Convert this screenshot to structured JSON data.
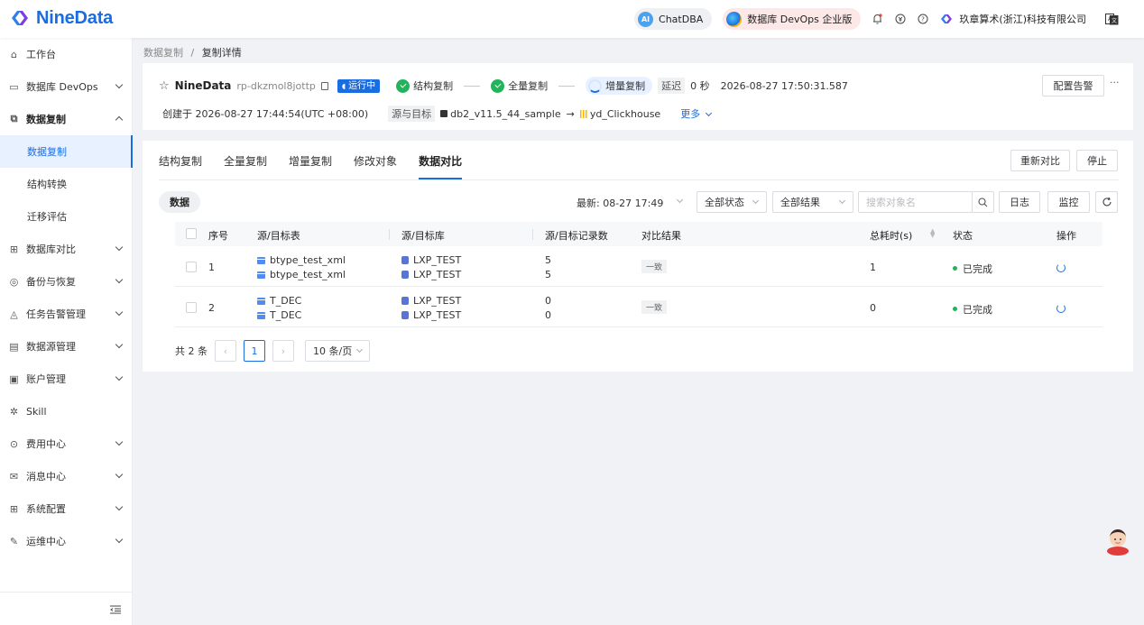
{
  "brand": {
    "name": "NineData",
    "color": "#1a6de0"
  },
  "topbar": {
    "chatdba": "ChatDBA",
    "devops": "数据库 DevOps 企业版",
    "company": "玖章算术(浙江)科技有限公司",
    "icons": [
      "bell-icon",
      "currency-icon",
      "help-icon",
      "translate-icon"
    ]
  },
  "sidebar": {
    "items": [
      {
        "label": "工作台",
        "icon": "home-icon"
      },
      {
        "label": "数据库 DevOps",
        "icon": "devops-icon"
      },
      {
        "label": "数据复制",
        "icon": "replication-icon"
      },
      {
        "label": "数据复制"
      },
      {
        "label": "结构转换"
      },
      {
        "label": "迁移评估"
      },
      {
        "label": "数据库对比",
        "icon": "compare-icon"
      },
      {
        "label": "备份与恢复",
        "icon": "backup-icon"
      },
      {
        "label": "任务告警管理",
        "icon": "alarm-icon"
      },
      {
        "label": "数据源管理",
        "icon": "datasource-icon"
      },
      {
        "label": "账户管理",
        "icon": "account-icon"
      },
      {
        "label": "Skill",
        "icon": "skill-icon"
      },
      {
        "label": "费用中心",
        "icon": "billing-icon"
      },
      {
        "label": "消息中心",
        "icon": "message-icon"
      },
      {
        "label": "系统配置",
        "icon": "settings-icon"
      },
      {
        "label": "运维中心",
        "icon": "ops-icon"
      }
    ]
  },
  "breadcrumb": {
    "parent": "数据复制",
    "sep": "/",
    "current": "复制详情"
  },
  "task": {
    "name": "NineData",
    "id": "rp-dkzmol8jottp",
    "status": "运行中",
    "steps": [
      "结构复制",
      "全量复制",
      "增量复制"
    ],
    "delay_label": "延迟",
    "delay_value": "0 秒",
    "timestamp": "2026-08-27 17:50:31.587",
    "created": "创建于 2026-08-27 17:44:54(UTC +08:00)",
    "src_tgt_label": "源与目标",
    "source": "db2_v11.5_44_sample",
    "arrow": "→",
    "target": "yd_Clickhouse",
    "more": "更多",
    "alert_btn": "配置告警",
    "more_icon": "···"
  },
  "tabs": [
    "结构复制",
    "全量复制",
    "增量复制",
    "修改对象",
    "数据对比"
  ],
  "active_tab": "数据对比",
  "actions": {
    "recompare": "重新对比",
    "stop": "停止"
  },
  "filters": {
    "chip": "数据",
    "latest": "最新: 08-27 17:49",
    "status": "全部状态",
    "result": "全部结果",
    "search_placeholder": "搜索对象名",
    "log": "日志",
    "monitor": "监控"
  },
  "table": {
    "headers": [
      "序号",
      "源/目标表",
      "源/目标库",
      "源/目标记录数",
      "对比结果",
      "总耗时(s)",
      "状态",
      "操作"
    ],
    "rows": [
      {
        "no": "1",
        "src_table": "btype_test_xml",
        "tgt_table": "btype_test_xml",
        "src_db": "LXP_TEST",
        "tgt_db": "LXP_TEST",
        "src_count": "5",
        "tgt_count": "5",
        "result": "一致",
        "time": "1",
        "status": "已完成"
      },
      {
        "no": "2",
        "src_table": "T_DEC",
        "tgt_table": "T_DEC",
        "src_db": "LXP_TEST",
        "tgt_db": "LXP_TEST",
        "src_count": "0",
        "tgt_count": "0",
        "result": "一致",
        "time": "0",
        "status": "已完成"
      }
    ]
  },
  "pager": {
    "total": "共 2 条",
    "page": "1",
    "size": "10 条/页"
  }
}
